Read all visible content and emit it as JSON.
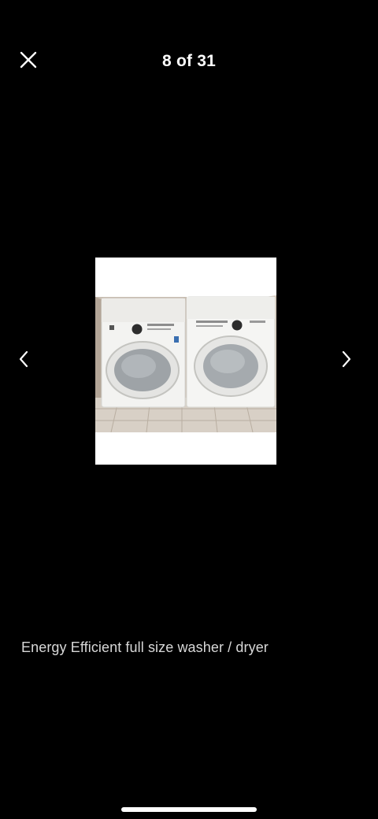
{
  "header": {
    "close_icon": "close-icon",
    "counter": "8 of 31"
  },
  "gallery": {
    "current_index": 8,
    "total": 31,
    "prev_icon": "chevron-left-icon",
    "next_icon": "chevron-right-icon",
    "photo_subject": "white front-load washer and dryer pair"
  },
  "caption": {
    "text": "Energy Efficient full size washer / dryer"
  },
  "colors": {
    "background": "#000000",
    "text": "#ffffff",
    "caption_text": "#d8d8d8"
  }
}
